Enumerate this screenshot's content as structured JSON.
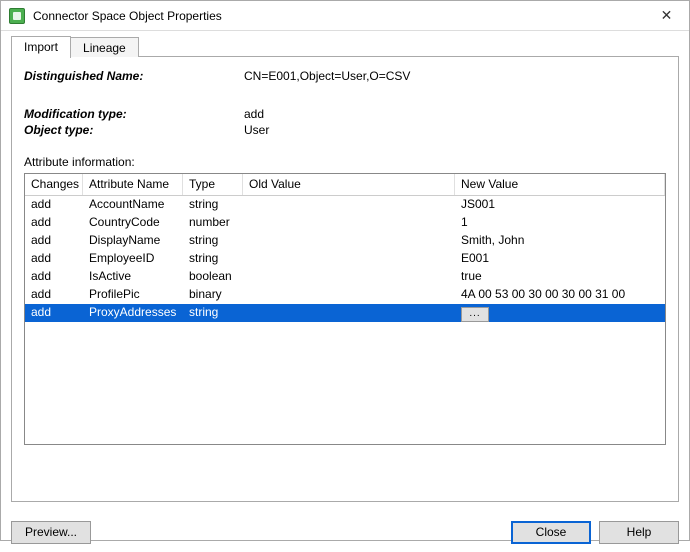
{
  "window": {
    "title": "Connector Space Object Properties",
    "close_glyph": "✕"
  },
  "tabs": [
    {
      "label": "Import",
      "active": true
    },
    {
      "label": "Lineage",
      "active": false
    }
  ],
  "fields": {
    "dn_label": "Distinguished Name:",
    "dn_value": "CN=E001,Object=User,O=CSV",
    "modtype_label": "Modification type:",
    "modtype_value": "add",
    "objtype_label": "Object type:",
    "objtype_value": "User",
    "attrinfo_label": "Attribute information:"
  },
  "grid": {
    "headers": {
      "changes": "Changes",
      "attribute": "Attribute Name",
      "type": "Type",
      "old": "Old Value",
      "new": "New Value"
    },
    "rows": [
      {
        "changes": "add",
        "attribute": "AccountName",
        "type": "string",
        "old": "",
        "new": "JS001"
      },
      {
        "changes": "add",
        "attribute": "CountryCode",
        "type": "number",
        "old": "",
        "new": "1"
      },
      {
        "changes": "add",
        "attribute": "DisplayName",
        "type": "string",
        "old": "",
        "new": "Smith, John"
      },
      {
        "changes": "add",
        "attribute": "EmployeeID",
        "type": "string",
        "old": "",
        "new": "E001"
      },
      {
        "changes": "add",
        "attribute": "IsActive",
        "type": "boolean",
        "old": "",
        "new": "true"
      },
      {
        "changes": "add",
        "attribute": "ProfilePic",
        "type": "binary",
        "old": "",
        "new": "4A 00 53 00 30 00 30 00 31 00"
      },
      {
        "changes": "add",
        "attribute": "ProxyAddresses",
        "type": "string",
        "old": "",
        "new_button": "...",
        "selected": true
      }
    ]
  },
  "buttons": {
    "preview": "Preview...",
    "close": "Close",
    "help": "Help"
  }
}
